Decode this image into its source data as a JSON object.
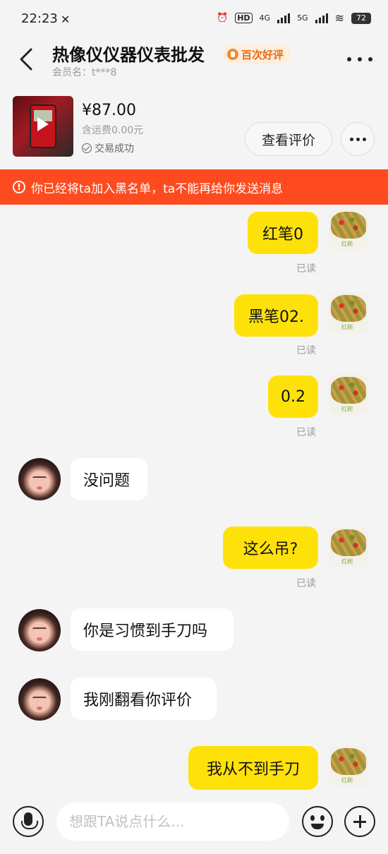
{
  "status_bar": {
    "time": "22:23",
    "tools_icon": "wrench-hammer-icon",
    "alarm_icon": "alarm-icon",
    "hd_label": "HD",
    "net1": "4G",
    "net2": "5G",
    "battery": "72"
  },
  "header": {
    "title": "热像仪仪器仪表批发",
    "badge": "百次好评",
    "member": "会员名：t***8"
  },
  "product": {
    "price": "¥87.00",
    "shipping": "含运费0.00元",
    "status": "交易成功",
    "review_button": "查看评价"
  },
  "banner": {
    "text": "你已经将ta加入黑名单，ta不能再给你发送消息"
  },
  "messages": [
    {
      "side": "me",
      "text": "红笔0",
      "status": "已读"
    },
    {
      "side": "me",
      "text": "黑笔02.",
      "status": "已读"
    },
    {
      "side": "me",
      "text": "0.2",
      "status": "已读"
    },
    {
      "side": "them",
      "text": "没问题"
    },
    {
      "side": "me",
      "text": "这么吊?",
      "status": "已读"
    },
    {
      "side": "them",
      "text": "你是习惯到手刀吗"
    },
    {
      "side": "them",
      "text": "我刚翻看你评价"
    },
    {
      "side": "me",
      "text": "我从不到手刀"
    }
  ],
  "input": {
    "placeholder": "想跟TA说点什么..."
  },
  "colors": {
    "my_bubble": "#ffe10a",
    "banner": "#fd4b1f",
    "badge_text": "#e86a16"
  }
}
